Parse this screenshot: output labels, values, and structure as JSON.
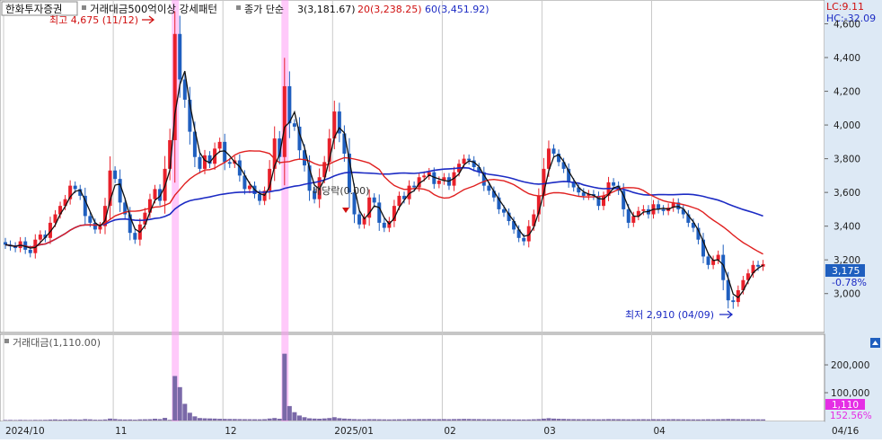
{
  "stock_name": "한화투자증권",
  "pattern_label": "거래대금500억이상 강세패턴",
  "ma_labels": {
    "title": "종가 단순",
    "ma3": "3(3,181.67)",
    "ma20": "20(3,238.25)",
    "ma60": "60(3,451.92)"
  },
  "lc_label": "LC:9.11",
  "hc_label": "HC:-32.09",
  "last_price_label": "3,175",
  "last_change_label": "-0.78%",
  "high_annotation": "최고 4,675 (11/12)",
  "low_annotation": "최저 2,910 (04/09)",
  "dividend_annotation": "배당락(0.00)",
  "volume_title": "거래대금(1,110.00)",
  "volume_last_label": "1,110",
  "volume_pct_label": "152.56%",
  "x_tick_labels": [
    "2024/10",
    "11",
    "12",
    "2025/01",
    "02",
    "03",
    "04",
    "04/16"
  ],
  "price_axis_labels": [
    "4,600",
    "4,400",
    "4,200",
    "4,000",
    "3,800",
    "3,600",
    "3,400",
    "3,200",
    "3,000"
  ],
  "volume_axis_labels": [
    "200,000",
    "100,000"
  ],
  "colors": {
    "up": "#e8202a",
    "down": "#1f5fbf",
    "ma3": "#111111",
    "ma20": "#e02020",
    "ma60": "#1c2bc4",
    "highlight": "#ff9df5",
    "volume_bar": "#7a69a8",
    "volume_last_bg": "#e52ee5"
  },
  "chart_data": {
    "type": "candlestick",
    "price_range": [
      2780,
      4720
    ],
    "volume_range": [
      0,
      255000
    ],
    "x_dates": [
      "2024/10",
      "11",
      "12",
      "2025/01",
      "02",
      "03",
      "04",
      "04/16"
    ],
    "highlight_dates": [
      "11/12",
      "12/04"
    ],
    "close_series": [
      3290,
      3280,
      3270,
      3310,
      3260,
      3240,
      3320,
      3350,
      3330,
      3420,
      3470,
      3520,
      3560,
      3640,
      3620,
      3580,
      3460,
      3420,
      3380,
      3400,
      3520,
      3730,
      3680,
      3540,
      3470,
      3360,
      3320,
      3410,
      3480,
      3560,
      3620,
      3550,
      3740,
      3910,
      4540,
      4270,
      4150,
      3960,
      3810,
      3740,
      3820,
      3770,
      3860,
      3900,
      3780,
      3770,
      3790,
      3700,
      3620,
      3640,
      3590,
      3550,
      3610,
      3740,
      3920,
      3810,
      4230,
      4010,
      3990,
      3850,
      3760,
      3610,
      3560,
      3690,
      3780,
      3920,
      4080,
      3950,
      3830,
      3600,
      3470,
      3410,
      3450,
      3570,
      3540,
      3420,
      3390,
      3430,
      3520,
      3580,
      3560,
      3640,
      3630,
      3690,
      3700,
      3720,
      3650,
      3670,
      3690,
      3640,
      3720,
      3770,
      3800,
      3790,
      3750,
      3720,
      3640,
      3610,
      3570,
      3500,
      3480,
      3430,
      3380,
      3330,
      3310,
      3400,
      3470,
      3580,
      3740,
      3860,
      3830,
      3780,
      3740,
      3660,
      3630,
      3600,
      3580,
      3590,
      3580,
      3520,
      3580,
      3660,
      3640,
      3610,
      3500,
      3420,
      3460,
      3490,
      3500,
      3470,
      3530,
      3500,
      3490,
      3510,
      3540,
      3500,
      3470,
      3420,
      3390,
      3320,
      3220,
      3170,
      3200,
      3230,
      3080,
      2960,
      2950,
      3020,
      3080,
      3120,
      3170,
      3160,
      3175
    ],
    "ma3_last": 3181.67,
    "ma20_last": 3238.25,
    "ma60_last": 3451.92,
    "high": {
      "price": 4675,
      "date": "11/12"
    },
    "low": {
      "price": 2910,
      "date": "04/09"
    },
    "volume_series": [
      2000,
      2200,
      1800,
      2500,
      2100,
      1900,
      2400,
      2300,
      2600,
      3500,
      4000,
      3200,
      3600,
      4100,
      3800,
      3400,
      5000,
      4200,
      3000,
      2800,
      3900,
      7000,
      5500,
      4000,
      3600,
      3800,
      3000,
      4200,
      4500,
      4800,
      6500,
      5200,
      9500,
      2500,
      160000,
      120000,
      60000,
      28000,
      15000,
      9000,
      8000,
      7500,
      7000,
      6200,
      5800,
      5600,
      5400,
      5100,
      4800,
      4700,
      4500,
      4400,
      4900,
      7200,
      9000,
      6500,
      240000,
      52000,
      30000,
      18000,
      12000,
      8000,
      7000,
      6500,
      7500,
      9000,
      12000,
      8500,
      7000,
      6000,
      5000,
      4500,
      4300,
      5000,
      4800,
      4500,
      4200,
      4000,
      4200,
      4500,
      4400,
      5000,
      4800,
      5200,
      5100,
      5300,
      4900,
      5000,
      5100,
      4800,
      5200,
      5500,
      5800,
      5600,
      5200,
      5000,
      4800,
      4600,
      4500,
      4400,
      4300,
      4200,
      4000,
      3900,
      3800,
      4000,
      4500,
      5200,
      6800,
      8500,
      7000,
      6200,
      5800,
      5200,
      5000,
      4800,
      4700,
      4800,
      4600,
      4400,
      4600,
      5100,
      5000,
      4800,
      4600,
      4400,
      4500,
      4600,
      4700,
      4500,
      4800,
      4600,
      4500,
      4700,
      4900,
      4600,
      4500,
      4300,
      4200,
      4000,
      4200,
      4500,
      4400,
      4600,
      5000,
      5500,
      5200,
      4800,
      4700,
      4600,
      4400,
      4300,
      4200
    ]
  }
}
